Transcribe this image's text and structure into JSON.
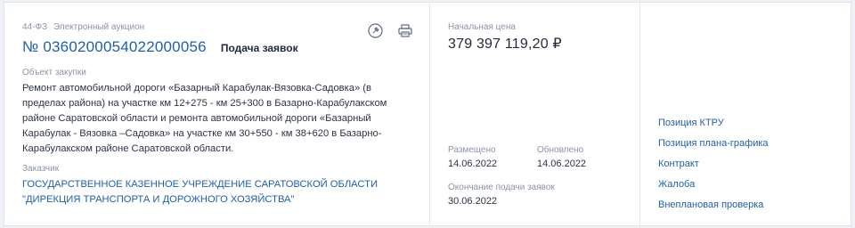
{
  "purchase": {
    "law": "44-ФЗ",
    "method": "Электронный аукцион",
    "number": "№ 0360200054022000056",
    "status": "Подача заявок",
    "object_label": "Объект закупки",
    "object_text": "Ремонт автомобильной дороги «Базарный Карабулак-Вязовка-Садовка» (в пределах района) на участке км 12+275 - км 25+300 в Базарно-Карабулакском районе Саратовской области и ремонта автомобильной дороги «Базарный Карабулак - Вязовка –Садовка» на участке км 30+550 - км 38+620 в Базарно-Карабулакском районе Саратовской области.",
    "customer_label": "Заказчик",
    "customer_name": "ГОСУДАРСТВЕННОЕ КАЗЕННОЕ УЧРЕЖДЕНИЕ САРАТОВСКОЙ ОБЛАСТИ \"ДИРЕКЦИЯ ТРАНСПОРТА И ДОРОЖНОГО ХОЗЯЙСТВА\""
  },
  "icons": {
    "favorite": "pin-icon",
    "print": "printer-icon"
  },
  "pricing": {
    "label": "Начальная цена",
    "value": "379 397 119,20 ₽"
  },
  "dates": {
    "posted_label": "Размещено",
    "posted_value": "14.06.2022",
    "updated_label": "Обновлено",
    "updated_value": "14.06.2022",
    "deadline_label": "Окончание подачи заявок",
    "deadline_value": "30.06.2022"
  },
  "links": [
    "Позиция КТРУ",
    "Позиция плана-графика",
    "Контракт",
    "Жалоба",
    "Внеплановая проверка"
  ],
  "colors": {
    "link": "#1f5fa8",
    "muted": "#8a94a6",
    "text": "#2b3447"
  }
}
